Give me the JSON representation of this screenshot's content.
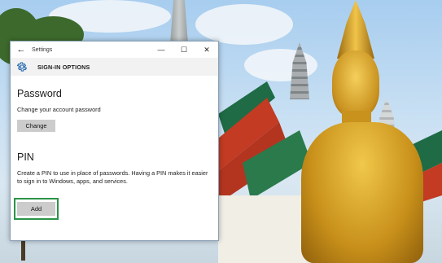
{
  "window": {
    "app_title": "Settings",
    "back_glyph": "←",
    "minimize_glyph": "—",
    "maximize_glyph": "☐",
    "close_glyph": "✕"
  },
  "header": {
    "icon": "gear-icon",
    "title": "SIGN-IN OPTIONS"
  },
  "password": {
    "title": "Password",
    "description": "Change your account password",
    "button_label": "Change"
  },
  "pin": {
    "title": "PIN",
    "description": "Create a PIN to use in place of passwords. Having a PIN makes it easier to sign in to Windows, apps, and services.",
    "button_label": "Add"
  },
  "colors": {
    "highlight_border": "#2a9447",
    "accent": "#2b6cb0",
    "button_bg": "#cccccc"
  }
}
